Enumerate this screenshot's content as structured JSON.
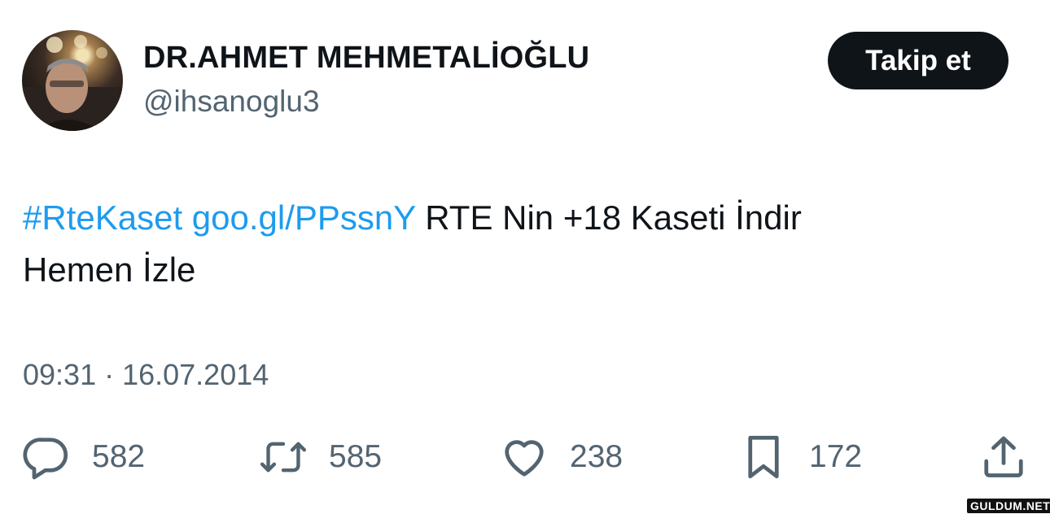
{
  "author": {
    "display_name": "DR.AHMET MEHMETALİOĞLU",
    "handle": "@ihsanoglu3",
    "avatar_icon": "profile-photo"
  },
  "follow_button": {
    "label": "Takip et"
  },
  "tweet": {
    "hashtag": "#RteKaset",
    "link": "goo.gl/PPssnY",
    "text_line1": "RTE Nin +18 Kaseti İndir",
    "text_line2": "Hemen İzle",
    "link_color": "#1d9bf0"
  },
  "timestamp": "09:31 · 16.07.2014",
  "actions": {
    "reply": {
      "icon": "reply-icon",
      "count": "582"
    },
    "retweet": {
      "icon": "retweet-icon",
      "count": "585"
    },
    "like": {
      "icon": "heart-icon",
      "count": "238"
    },
    "bookmark": {
      "icon": "bookmark-icon",
      "count": "172"
    },
    "share": {
      "icon": "share-icon"
    }
  },
  "watermark": "GULDUM.NET"
}
